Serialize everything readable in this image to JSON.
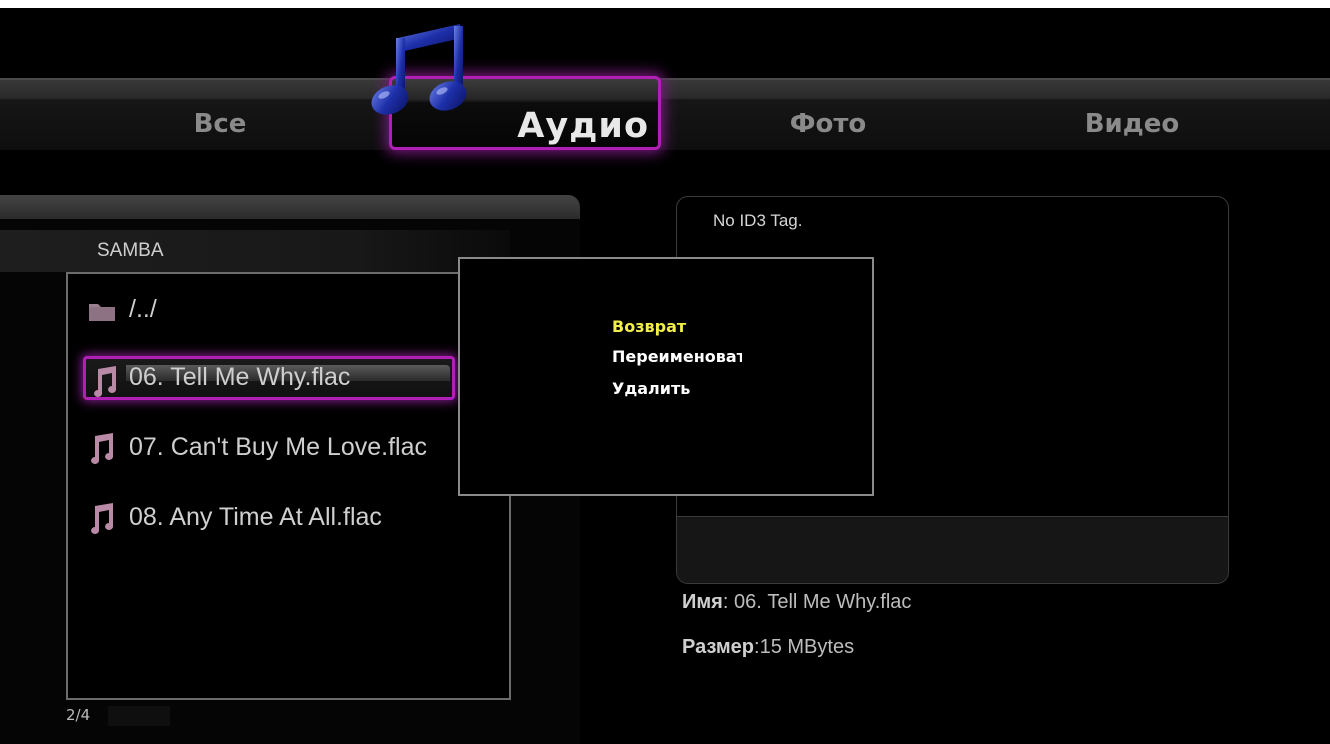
{
  "tabs": [
    {
      "label": "Все",
      "active": false
    },
    {
      "label": "Аудио",
      "active": true
    },
    {
      "label": "Фото",
      "active": false
    },
    {
      "label": "Видео",
      "active": false
    }
  ],
  "browser": {
    "path": "SAMBA",
    "items": [
      {
        "name": "/../",
        "icon": "folder-icon"
      },
      {
        "name": "06. Tell Me Why.flac",
        "icon": "music-note-icon",
        "selected": true
      },
      {
        "name": "07. Can't Buy Me Love.flac",
        "icon": "music-note-icon"
      },
      {
        "name": "08. Any Time At All.flac",
        "icon": "music-note-icon"
      }
    ],
    "page_counter": "2/4"
  },
  "info": {
    "tag_text": "No ID3 Tag.",
    "name_label": "Имя",
    "name_value": ": 06. Tell Me Why.flac",
    "size_label": "Размер",
    "size_value": ":15 MBytes"
  },
  "context_menu": {
    "items": [
      {
        "label": "Возврат",
        "active": true
      },
      {
        "label": "Переименовать",
        "active": false
      },
      {
        "label": "Удалить",
        "active": false
      }
    ]
  },
  "colors": {
    "accent": "#b21fb6",
    "menu_highlight": "#f2ee4a"
  }
}
